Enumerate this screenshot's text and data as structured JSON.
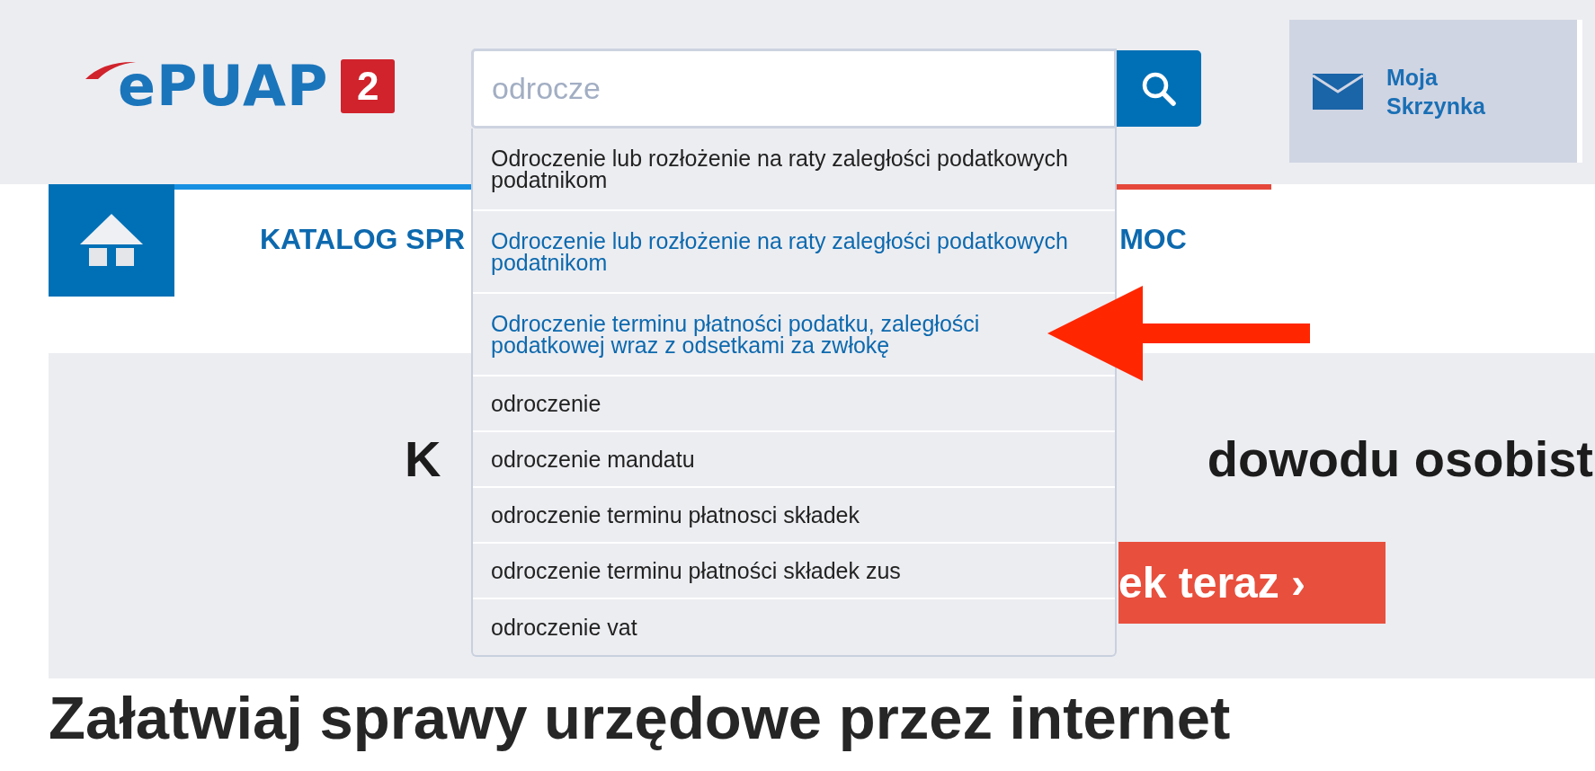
{
  "logo": {
    "text": "ePUAP",
    "badge": "2"
  },
  "search": {
    "value": "odrocze"
  },
  "mailbox": {
    "label_line_1": "Moja",
    "label_line_2": "Skrzynka"
  },
  "nav": {
    "items": [
      "KATALOG SPR",
      "MOC"
    ]
  },
  "suggestions": [
    {
      "kind": "phrase",
      "text": "Odroczenie lub rozłożenie na raty zaległości podatkowych podatnikom"
    },
    {
      "kind": "service",
      "text": "Odroczenie lub rozłożenie na raty zaległości podatkowych podatnikom"
    },
    {
      "kind": "service",
      "text": "Odroczenie terminu płatności podatku, zaległości podatkowej wraz z odsetkami za zwłokę"
    },
    {
      "kind": "phrase",
      "text": "odroczenie"
    },
    {
      "kind": "phrase",
      "text": "odroczenie mandatu"
    },
    {
      "kind": "phrase",
      "text": "odroczenie terminu płatnosci składek"
    },
    {
      "kind": "phrase",
      "text": "odroczenie terminu płatności składek zus"
    },
    {
      "kind": "phrase",
      "text": "odroczenie vat"
    }
  ],
  "banner": {
    "title_left": "K",
    "title_right": "dowodu osobist",
    "button": "ek teraz ›"
  },
  "heading": "Załatwiaj sprawy urzędowe przez internet"
}
